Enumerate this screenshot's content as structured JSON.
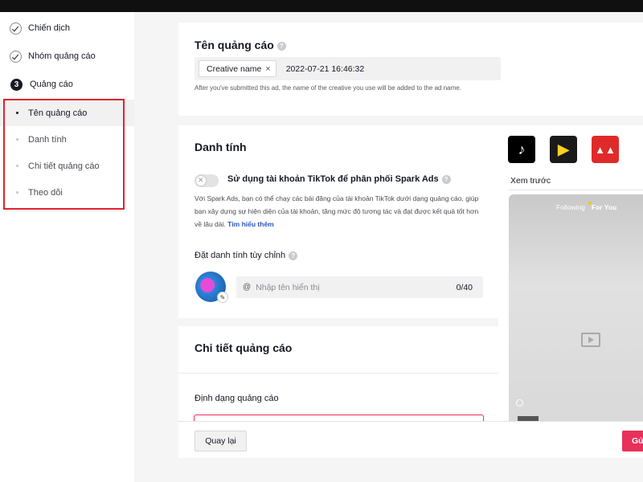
{
  "sidebar": {
    "steps": [
      {
        "label": "Chiến dịch"
      },
      {
        "label": "Nhóm quảng cáo"
      },
      {
        "number": "3",
        "label": "Quảng cáo"
      }
    ],
    "substeps": [
      {
        "label": "Tên quảng cáo",
        "active": true
      },
      {
        "label": "Danh tính",
        "active": false
      },
      {
        "label": "Chi tiết quảng cáo",
        "active": false
      },
      {
        "label": "Theo dõi",
        "active": false
      }
    ]
  },
  "ad_name": {
    "title": "Tên quảng cáo",
    "chip_label": "Creative name",
    "date_value": "2022-07-21 16:46:32",
    "hint": "After you've submitted this ad, the name of the creative you use will be added to the ad name."
  },
  "identity": {
    "title": "Danh tính",
    "spark_label": "Sử dụng tài khoản TikTok để phân phối Spark Ads",
    "spark_desc": "Với Spark Ads, bạn có thể chạy các bài đăng của tài khoản TikTok dưới dạng quảng cáo, giúp bạn xây dựng sự hiện diện của tài khoản, tăng mức độ tương tác và đạt được kết quả tốt hơn về lâu dài.",
    "learn_more": "Tìm hiểu thêm",
    "custom_label": "Đặt danh tính tùy chỉnh",
    "name_placeholder": "Nhập tên hiển thị",
    "name_count": "0/40"
  },
  "ad_details": {
    "title": "Chi tiết quảng cáo",
    "format_label": "Định dạng quảng cáo"
  },
  "preview": {
    "tab_label": "Xem trước",
    "phone_tab_following": "Following",
    "phone_tab_foryou": "For You",
    "placement_icons": [
      "tiktok-icon",
      "buzzvideo-icon",
      "pangle-icon"
    ]
  },
  "footer": {
    "back_label": "Quay lại",
    "submit_label": "Gửi"
  },
  "colors": {
    "accent": "#e8305a",
    "highlight": "#e0222d",
    "link": "#2a56c6"
  }
}
